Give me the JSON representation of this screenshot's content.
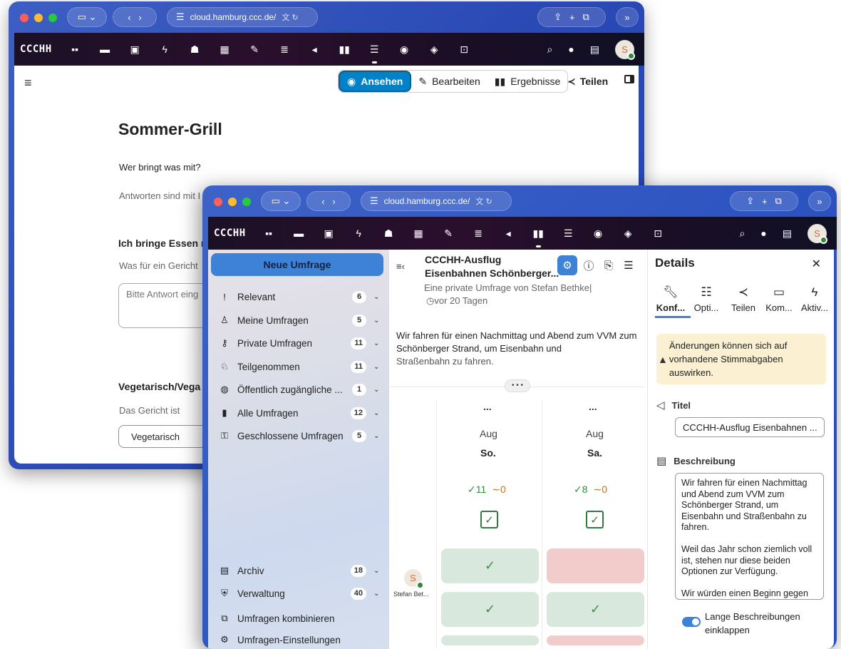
{
  "browser": {
    "url": "cloud.hamburg.ccc.de/",
    "translate_icon": "translate-icon"
  },
  "nextcloud": {
    "brand": "CCCHH",
    "apps": [
      "dashboard-icon",
      "files-icon",
      "photos-icon",
      "activity-icon",
      "contacts-icon",
      "calendar-icon",
      "notes-icon",
      "deck-icon",
      "announcements-icon",
      "polls-icon",
      "tasks-icon",
      "talk-icon",
      "maps-icon",
      "passwords-icon"
    ],
    "user_initial": "S"
  },
  "window1": {
    "toolbar": {
      "view_label": "Ansehen",
      "edit_label": "Bearbeiten",
      "results_label": "Ergebnisse",
      "share_label": "Teilen"
    },
    "form": {
      "title": "Sommer-Grill",
      "description": "Wer bringt was mit?",
      "hint": "Antworten sind mit I",
      "q1_title": "Ich bringe Essen n",
      "q1_sub": "Was für ein Gericht",
      "q1_placeholder": "Bitte Antwort eing",
      "q2_title": "Vegetarisch/Vega",
      "q2_sub": "Das Gericht ist",
      "q2_option": "Vegetarisch"
    }
  },
  "window2": {
    "nav": {
      "new_poll": "Neue Umfrage",
      "items": [
        {
          "icon": "!",
          "label": "Relevant",
          "count": "6"
        },
        {
          "icon": "♙",
          "label": "Meine Umfragen",
          "count": "5"
        },
        {
          "icon": "⚷",
          "label": "Private Umfragen",
          "count": "11"
        },
        {
          "icon": "♘",
          "label": "Teilgenommen",
          "count": "11"
        },
        {
          "icon": "◍",
          "label": "Öffentlich zugängliche ...",
          "count": "1"
        },
        {
          "icon": "▮",
          "label": "Alle Umfragen",
          "count": "12"
        },
        {
          "icon": "⚿",
          "label": "Geschlossene Umfragen",
          "count": "5"
        }
      ],
      "bottom": [
        {
          "icon": "▤",
          "label": "Archiv",
          "count": "18"
        },
        {
          "icon": "⛨",
          "label": "Verwaltung",
          "count": "40"
        }
      ],
      "links": [
        {
          "icon": "⧉",
          "label": "Umfragen kombinieren"
        },
        {
          "icon": "⚙",
          "label": "Umfragen-Einstellungen"
        }
      ]
    },
    "poll": {
      "title_line1": "CCCHH-Ausflug",
      "title_line2": "Eisenbahnen Schönberger...",
      "subtitle": "Eine private Umfrage von Stefan Bethke|",
      "age": "vor 20 Tagen",
      "description_1": "Wir fahren für einen Nachmittag und Abend zum VVM zum Schönberger Strand, um Eisenbahn und",
      "description_2": "Straßenbahn zu fahren.",
      "more": "• • •",
      "options": [
        {
          "dots": "...",
          "month": "Aug",
          "day": "So.",
          "yes": "11",
          "maybe": "0"
        },
        {
          "dots": "...",
          "month": "Aug",
          "day": "Sa.",
          "yes": "8",
          "maybe": "0"
        }
      ],
      "user_name": "Stefan Bet...",
      "user_initial": "S"
    },
    "details": {
      "title": "Details",
      "tabs": [
        {
          "icon": "wrench-icon",
          "label": "Konf..."
        },
        {
          "icon": "checklist-icon",
          "label": "Opti..."
        },
        {
          "icon": "share-icon",
          "label": "Teilen"
        },
        {
          "icon": "comment-icon",
          "label": "Kom..."
        },
        {
          "icon": "activity-icon",
          "label": "Aktiv..."
        }
      ],
      "warning": "Änderungen können sich auf vorhandene Stimmabgaben auswirken.",
      "title_label": "Titel",
      "title_value": "CCCHH-Ausflug Eisenbahnen ...",
      "description_label": "Beschreibung",
      "description_p1": "Wir fahren für einen Nachmittag und Abend zum VVM zum Schönberger Strand, um Eisenbahn und Straßenbahn zu fahren.",
      "description_p2": "Weil das Jahr schon ziemlich voll ist, stehen nur diese beiden Optionen zur Verfügung.",
      "description_p3": "Wir würden einen Beginn gegen",
      "toggle_label": "Lange Beschreibungen einklappen"
    }
  },
  "colors": {
    "primary": "#3e82d8",
    "yes_bg": "#d8e8dc",
    "no_bg": "#f2cbcb",
    "warning_bg": "#fbf0d2"
  }
}
